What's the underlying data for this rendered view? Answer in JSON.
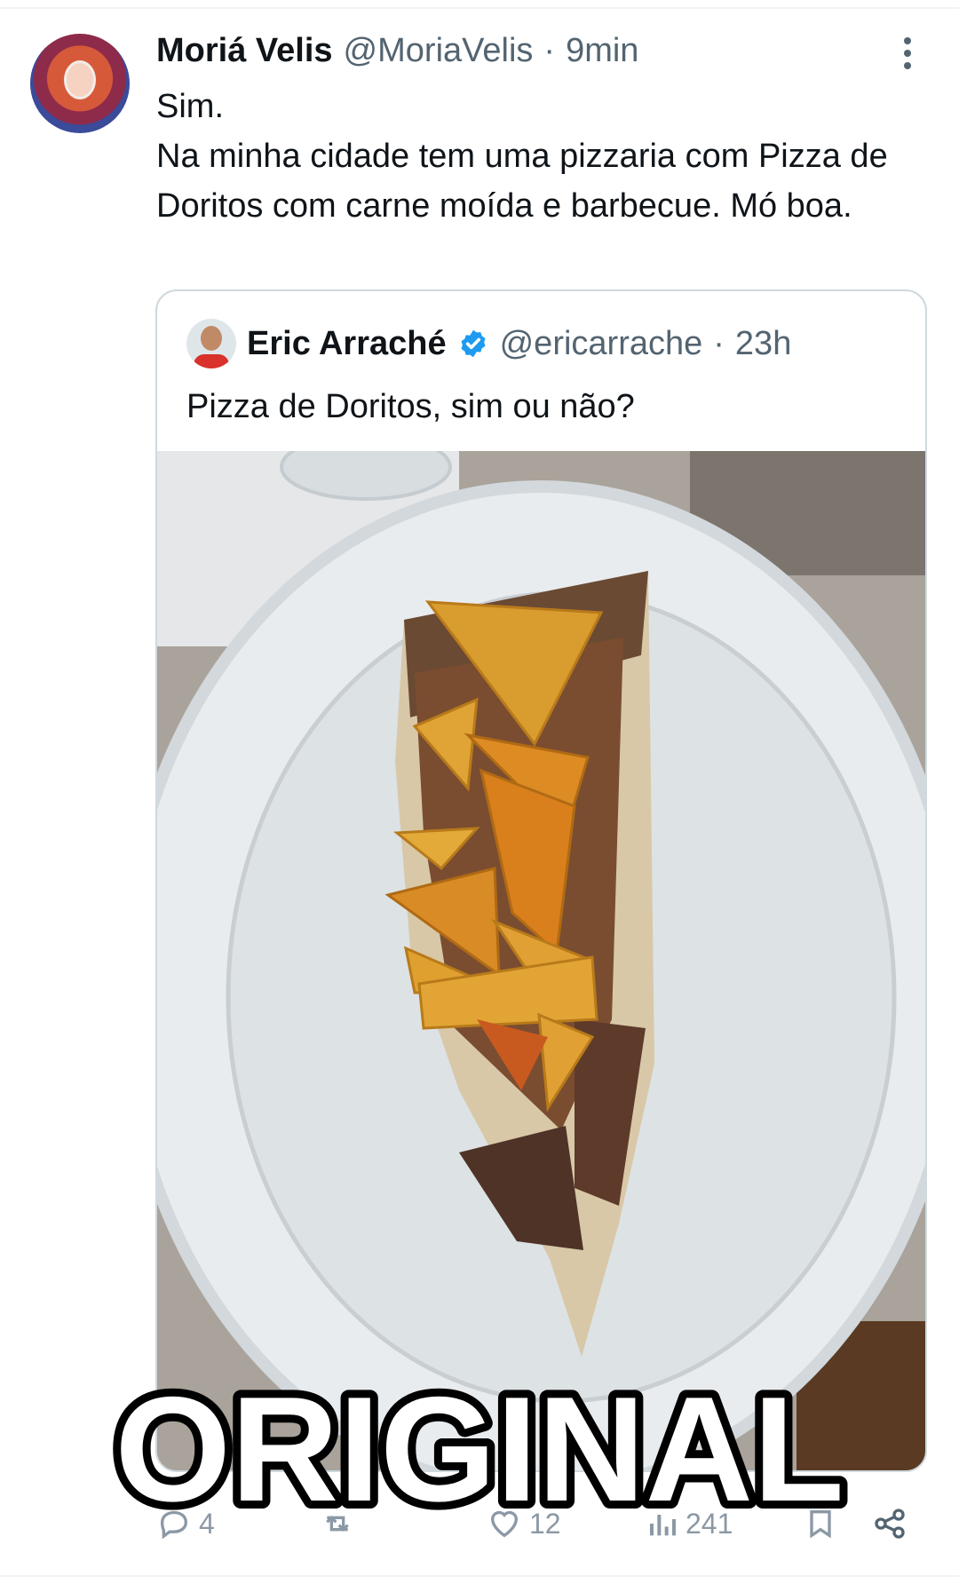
{
  "tweet": {
    "author_name": "Moriá Velis",
    "author_handle": "@MoriaVelis",
    "separator": "·",
    "time": "9min",
    "text_lines": [
      "Sim.",
      "Na minha cidade tem uma pizzaria com Pizza de Doritos com carne moída e barbecue. Mó boa."
    ]
  },
  "quoted_tweet": {
    "author_name": "Eric Arraché",
    "author_handle": "@ericarrache",
    "separator": "·",
    "time": "23h",
    "text": "Pizza de Doritos, sim ou não?",
    "verified": true
  },
  "actions": {
    "reply_count": "4",
    "like_count": "12",
    "views_count": "241"
  },
  "watermark": {
    "text": "ORIGINAL"
  },
  "colors": {
    "text_primary": "#0f1419",
    "text_secondary": "#536471",
    "border": "#cfd9de",
    "verified": "#1d9bf0"
  },
  "icons": [
    "more-vertical-icon",
    "verified-badge-icon",
    "reply-icon",
    "retweet-icon",
    "like-icon",
    "views-icon",
    "bookmark-icon",
    "share-icon"
  ]
}
